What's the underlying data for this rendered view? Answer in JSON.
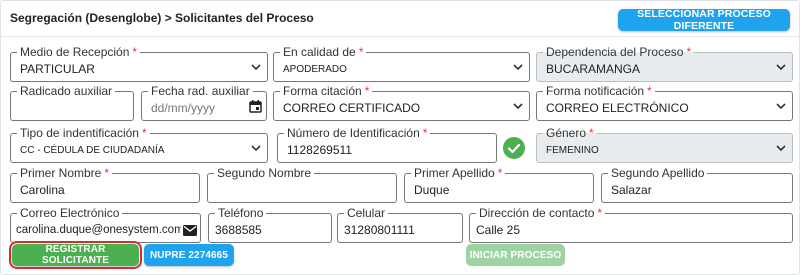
{
  "header": {
    "breadcrumb": "Segregación (Desenglobe) > Solicitantes del Proceso",
    "select_process_button": "SELECCIONAR PROCESO DIFERENTE"
  },
  "form": {
    "medio_recepcion": {
      "label": "Medio de Recepción",
      "value": "PARTICULAR"
    },
    "en_calidad_de": {
      "label": "En calidad de",
      "value": "APODERADO"
    },
    "dependencia": {
      "label": "Dependencia del Proceso",
      "value": "BUCARAMANGA"
    },
    "radicado_auxiliar": {
      "label": "Radicado auxiliar",
      "value": ""
    },
    "fecha_rad_auxiliar": {
      "label": "Fecha rad. auxiliar",
      "placeholder": "dd/mm/yyyy"
    },
    "forma_citacion": {
      "label": "Forma citación",
      "value": "CORREO CERTIFICADO"
    },
    "forma_notificacion": {
      "label": "Forma notificación",
      "value": "CORREO ELECTRÓNICO"
    },
    "tipo_identificacion": {
      "label": "Tipo de indentificación",
      "value": "CC - CÉDULA DE CIUDADANÍA"
    },
    "numero_identificacion": {
      "label": "Número de Identificación",
      "value": "1128269511"
    },
    "genero": {
      "label": "Género",
      "value": "FEMENINO"
    },
    "primer_nombre": {
      "label": "Primer Nombre",
      "value": "Carolina"
    },
    "segundo_nombre": {
      "label": "Segundo Nombre",
      "value": ""
    },
    "primer_apellido": {
      "label": "Primer Apellido",
      "value": "Duque"
    },
    "segundo_apellido": {
      "label": "Segundo Apellido",
      "value": "Salazar"
    },
    "correo": {
      "label": "Correo Electrónico",
      "value": "carolina.duque@onesystem.com.co"
    },
    "telefono": {
      "label": "Teléfono",
      "value": "3688585"
    },
    "celular": {
      "label": "Celular",
      "value": "31280801111"
    },
    "direccion": {
      "label": "Dirección de contacto",
      "value": "Calle 25"
    }
  },
  "actions": {
    "registrar": "REGISTRAR SOLICITANTE",
    "nupre": "NUPRE 2274665",
    "iniciar": "INICIAR PROCESO"
  },
  "colors": {
    "primary": "#20a3ee",
    "success": "#4caf50",
    "required": "#e53935"
  }
}
